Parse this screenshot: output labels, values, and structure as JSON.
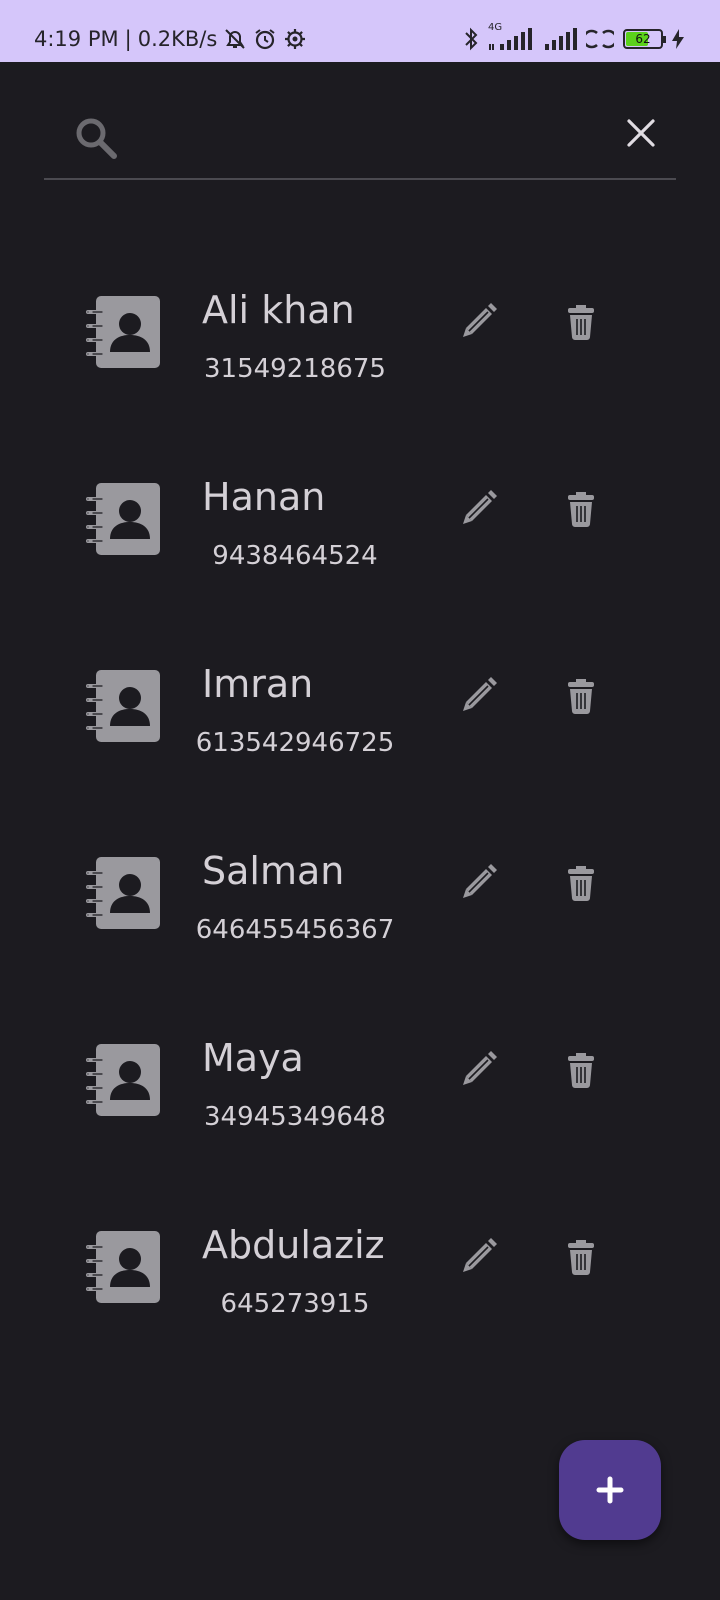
{
  "status_bar": {
    "time": "4:19 PM",
    "net_speed": "0.2KB/s",
    "network_type": "4G",
    "battery_level": "62",
    "icons": [
      "mute-icon",
      "alarm-icon",
      "settings-icon",
      "bluetooth-icon",
      "signal-icon",
      "signal-icon",
      "hotspot-icon",
      "battery-icon",
      "charging-icon"
    ]
  },
  "search": {
    "placeholder": "",
    "value": "",
    "icons": [
      "search-icon",
      "close-icon"
    ]
  },
  "contacts": [
    {
      "name": "Ali khan",
      "phone": "31549218675"
    },
    {
      "name": "Hanan",
      "phone": "9438464524"
    },
    {
      "name": "Imran",
      "phone": "613542946725"
    },
    {
      "name": "Salman",
      "phone": "646455456367"
    },
    {
      "name": "Maya",
      "phone": "34945349648"
    },
    {
      "name": "Abdulaziz",
      "phone": "645273915"
    }
  ],
  "row_icons": [
    "contact-book-icon",
    "pencil-icon",
    "trash-icon"
  ],
  "fab_icon": "plus-icon",
  "colors": {
    "status_bar_bg": "#d5c6fa",
    "background": "#1c1b20",
    "icon_gray": "#9a999e",
    "text": "#d4d0d6",
    "fab": "#513b90",
    "battery_green": "#5bd11b"
  }
}
